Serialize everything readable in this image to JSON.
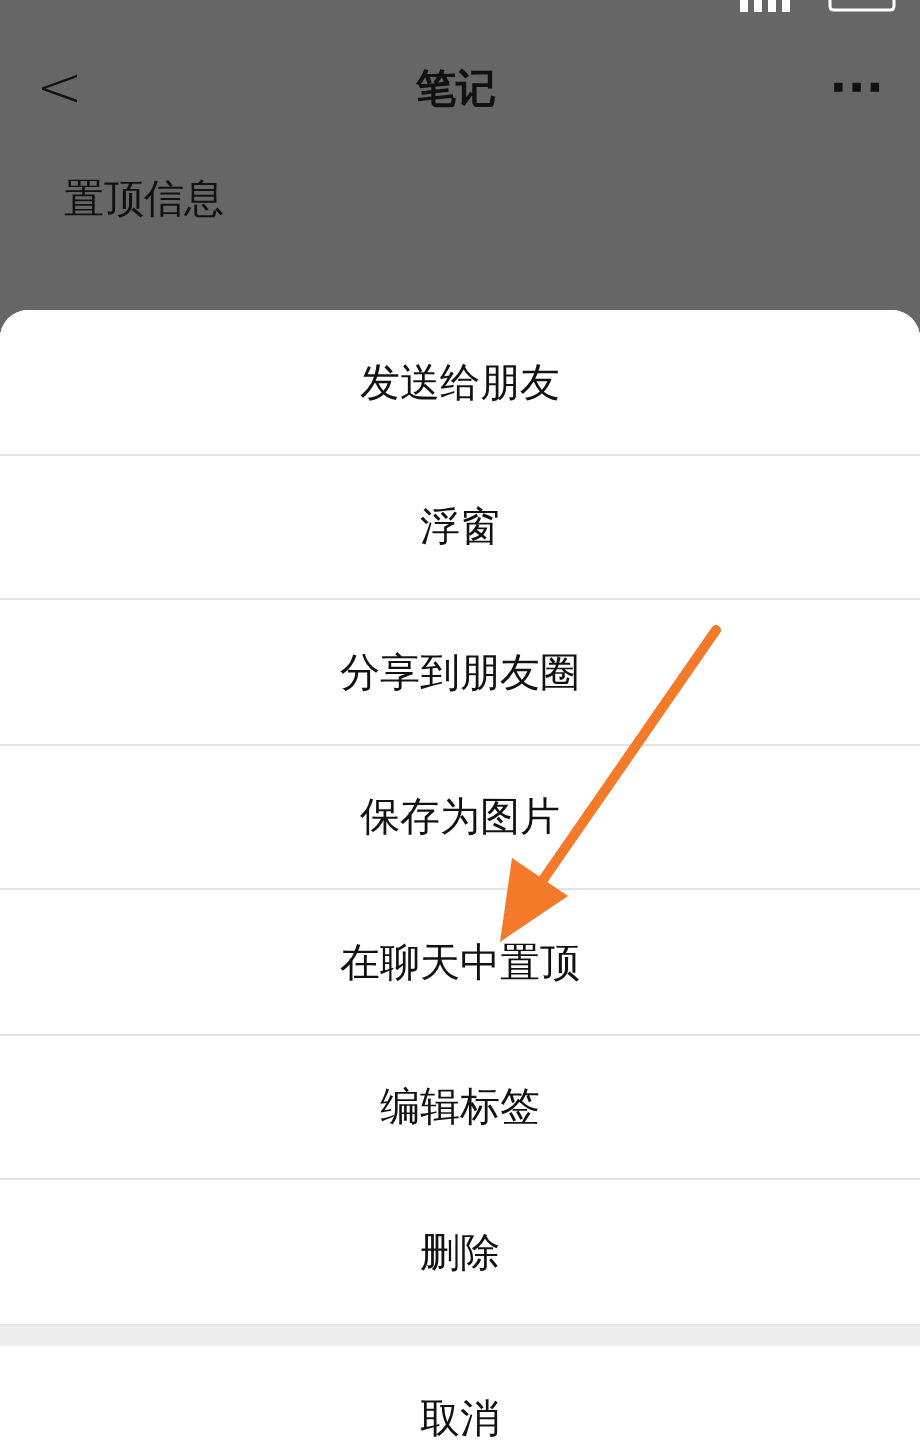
{
  "nav": {
    "back": "<",
    "title": "笔记",
    "more": "···"
  },
  "content": {
    "title": "置顶信息"
  },
  "sheet": {
    "items": [
      {
        "label": "发送给朋友"
      },
      {
        "label": "浮窗"
      },
      {
        "label": "分享到朋友圈"
      },
      {
        "label": "保存为图片"
      },
      {
        "label": "在聊天中置顶"
      },
      {
        "label": "编辑标签"
      },
      {
        "label": "删除"
      }
    ],
    "cancel": "取消"
  }
}
